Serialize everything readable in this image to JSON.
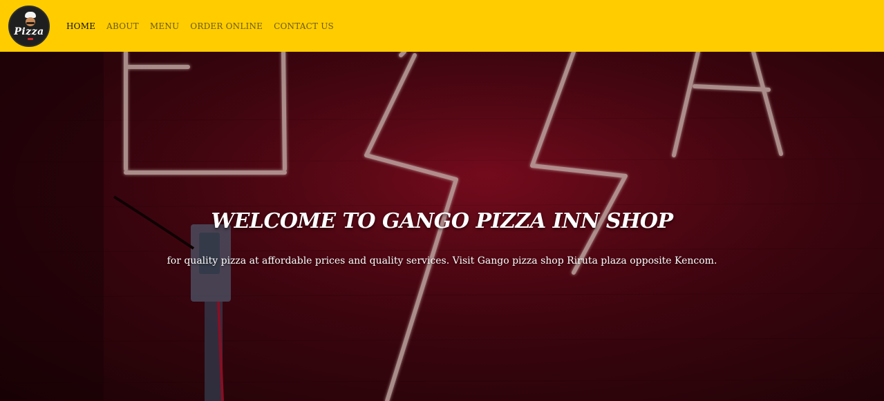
{
  "brand": {
    "logo_text": "Pizza"
  },
  "nav": {
    "items": [
      {
        "label": "HOME",
        "active": true
      },
      {
        "label": "ABOUT",
        "active": false
      },
      {
        "label": "MENU",
        "active": false
      },
      {
        "label": "ORDER ONLINE",
        "active": false
      },
      {
        "label": "CONTACT US",
        "active": false
      }
    ]
  },
  "hero": {
    "title": "WELCOME TO GANGO PIZZA INN SHOP",
    "subtitle": "for quality pizza at affordable prices and quality services. Visit Gango pizza shop Riruta plaza opposite Kencom."
  },
  "colors": {
    "navbar_bg": "#ffcc00",
    "nav_text": "#6b5a17",
    "nav_active": "#111111",
    "hero_red": "#7a0a1c",
    "neon_tube": "#e8c9c4"
  }
}
